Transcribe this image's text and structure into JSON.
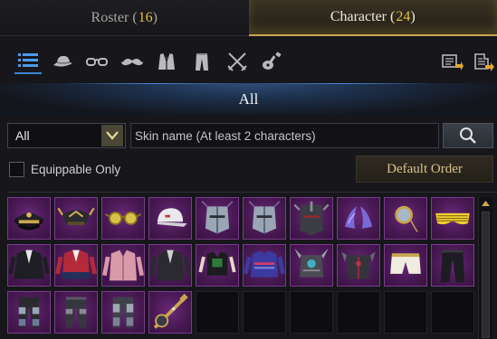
{
  "tabs": {
    "roster": {
      "label": "Roster",
      "count": "16"
    },
    "character": {
      "label": "Character",
      "count": "24"
    }
  },
  "categories": [
    {
      "name": "all-list-icon",
      "active": true
    },
    {
      "name": "hat-icon",
      "active": false
    },
    {
      "name": "glasses-icon",
      "active": false
    },
    {
      "name": "mustache-icon",
      "active": false
    },
    {
      "name": "suit-icon",
      "active": false
    },
    {
      "name": "pants-icon",
      "active": false
    },
    {
      "name": "crossed-swords-icon",
      "active": false
    },
    {
      "name": "instrument-icon",
      "active": false
    },
    {
      "name": "preset-import-icon",
      "active": false
    },
    {
      "name": "preset-export-icon",
      "active": false
    }
  ],
  "banner": {
    "title": "All"
  },
  "filter": {
    "select_value": "All",
    "search_placeholder": "Skin name (At least 2 characters)"
  },
  "options": {
    "equippable_label": "Equippable Only",
    "equippable_checked": false,
    "sort_label": "Default Order"
  },
  "colors": {
    "accent_gold": "#c9a64e",
    "count_yellow": "#e2c043",
    "active_blue": "#3b86d6",
    "item_purple": "#4a1a55"
  },
  "grid": {
    "items": [
      {
        "icon": "officer-cap-icon",
        "filled": true
      },
      {
        "icon": "horned-helmet-icon",
        "filled": true
      },
      {
        "icon": "gold-glasses-icon",
        "filled": true
      },
      {
        "icon": "white-cap-icon",
        "filled": true
      },
      {
        "icon": "knight-helm-icon",
        "filled": true
      },
      {
        "icon": "knight-helm-icon",
        "filled": true
      },
      {
        "icon": "dark-helm-icon",
        "filled": true
      },
      {
        "icon": "horn-ornament-icon",
        "filled": true
      },
      {
        "icon": "monocle-icon",
        "filled": true
      },
      {
        "icon": "shutter-glasses-icon",
        "filled": true
      },
      {
        "icon": "black-suit-icon",
        "filled": true
      },
      {
        "icon": "red-jacket-icon",
        "filled": true
      },
      {
        "icon": "pink-suit-icon",
        "filled": true
      },
      {
        "icon": "dark-suit-icon",
        "filled": true
      },
      {
        "icon": "black-top-icon",
        "filled": true
      },
      {
        "icon": "blue-sweater-icon",
        "filled": true
      },
      {
        "icon": "spiked-armor-icon",
        "filled": true
      },
      {
        "icon": "dark-armor-icon",
        "filled": true
      },
      {
        "icon": "white-shorts-icon",
        "filled": true
      },
      {
        "icon": "black-pants-icon",
        "filled": true
      },
      {
        "icon": "armored-leggings-icon",
        "filled": true
      },
      {
        "icon": "dark-leggings-icon",
        "filled": true
      },
      {
        "icon": "plated-leggings-icon",
        "filled": true
      },
      {
        "icon": "ornate-instrument-icon",
        "filled": true
      },
      {
        "icon": "",
        "filled": false
      },
      {
        "icon": "",
        "filled": false
      },
      {
        "icon": "",
        "filled": false
      },
      {
        "icon": "",
        "filled": false
      },
      {
        "icon": "",
        "filled": false
      },
      {
        "icon": "",
        "filled": false
      }
    ]
  }
}
